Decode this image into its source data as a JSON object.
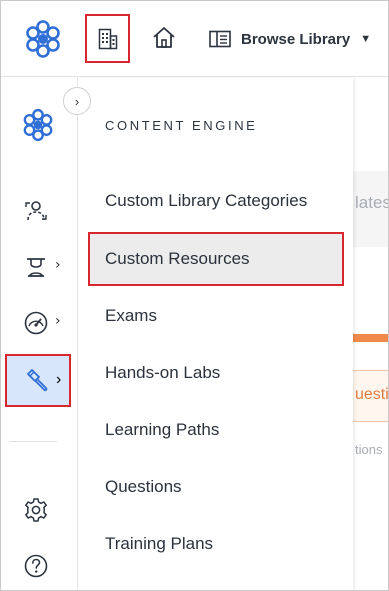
{
  "topbar": {
    "logo_icon": "flower-logo-icon",
    "building_icon": "building-icon",
    "home_icon": "home-icon",
    "browse_library": {
      "icon": "book-open-icon",
      "label": "Browse Library",
      "caret": "▼"
    }
  },
  "rail": {
    "logo_icon": "flower-logo-icon",
    "expand_toggle": "›",
    "items": [
      {
        "icon": "users-icon"
      },
      {
        "icon": "exam-icon",
        "chevron": "›"
      },
      {
        "icon": "dashboard-gauge-icon",
        "chevron": "›"
      },
      {
        "icon": "paint-brush-icon",
        "chevron": "›",
        "active": true
      },
      {
        "icon": "gear-icon"
      },
      {
        "icon": "help-icon"
      }
    ]
  },
  "panel": {
    "heading": "CONTENT ENGINE",
    "items": [
      {
        "label": "Custom Library Categories"
      },
      {
        "label": "Custom Resources",
        "selected": true
      },
      {
        "label": "Exams"
      },
      {
        "label": "Hands-on Labs"
      },
      {
        "label": "Learning Paths"
      },
      {
        "label": "Questions"
      },
      {
        "label": "Training Plans"
      }
    ]
  },
  "background": {
    "text1": "lates",
    "text2": "uesti",
    "text3": "tions"
  },
  "colors": {
    "highlight_border": "#d8262f",
    "brand_blue": "#2f6fd6",
    "active_bg": "#d8e6fb",
    "selected_bg": "#ececec",
    "accent_orange": "#f08a4b"
  }
}
